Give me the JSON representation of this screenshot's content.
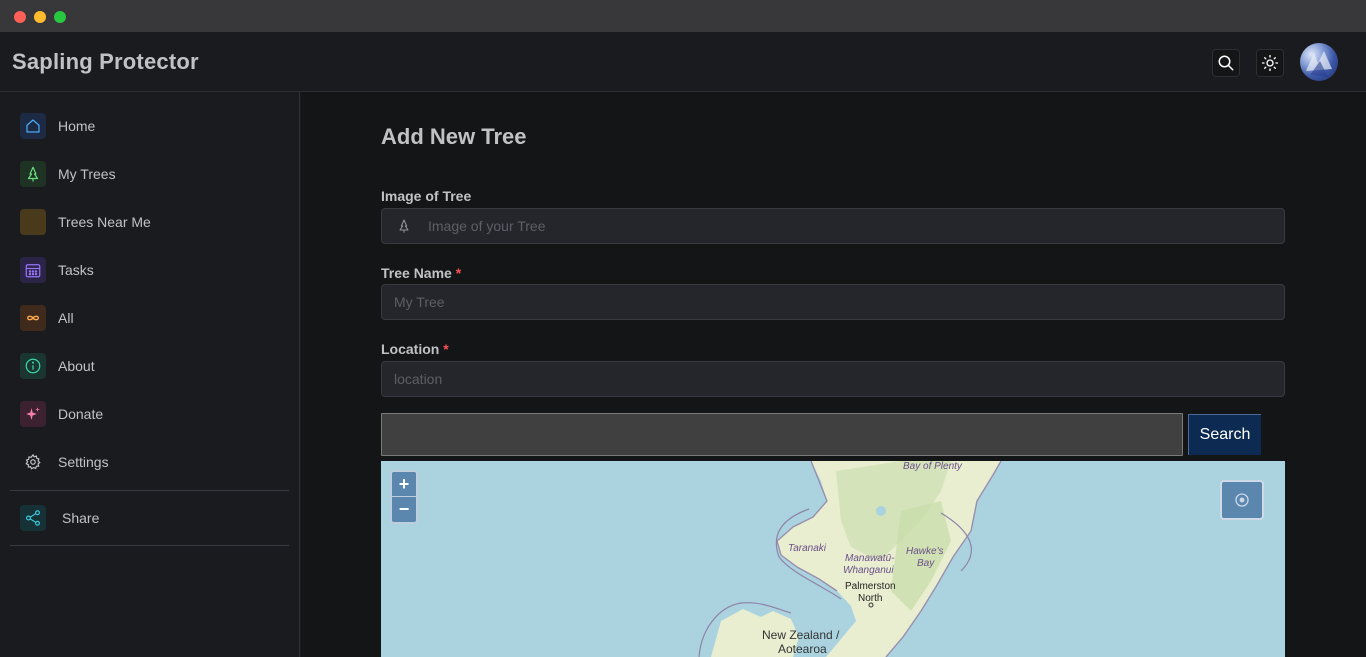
{
  "app": {
    "title": "Sapling Protector"
  },
  "sidebar": {
    "items": [
      {
        "label": "Home",
        "icon": "home-icon",
        "color": "#4dabf7",
        "bg": "#1c2a44"
      },
      {
        "label": "My Trees",
        "icon": "tree-icon",
        "color": "#69db7c",
        "bg": "#1f3324"
      },
      {
        "label": "Trees Near Me",
        "icon": "",
        "color": "#fcc419",
        "bg": "#4a3a1c"
      },
      {
        "label": "Tasks",
        "icon": "calendar-icon",
        "color": "#9775fa",
        "bg": "#2c2446"
      },
      {
        "label": "All",
        "icon": "infinity-icon",
        "color": "#ffa94d",
        "bg": "#3f2a1c"
      },
      {
        "label": "About",
        "icon": "info-icon",
        "color": "#38d9a9",
        "bg": "#1b3530"
      },
      {
        "label": "Donate",
        "icon": "sparkles-icon",
        "color": "#f783ac",
        "bg": "#3c2230"
      },
      {
        "label": "Settings",
        "icon": "gear-icon",
        "color": "#c1c2c5",
        "bg": "#1a1b1e"
      }
    ],
    "share": {
      "label": "Share",
      "icon": "share-icon",
      "color": "#3bc9db",
      "bg": "#163236"
    }
  },
  "form": {
    "title": "Add New Tree",
    "image": {
      "label": "Image of Tree",
      "placeholder": "Image of your Tree"
    },
    "name": {
      "label": "Tree Name",
      "required_mark": "*",
      "placeholder": "My Tree"
    },
    "location": {
      "label": "Location",
      "required_mark": "*",
      "placeholder": "location"
    }
  },
  "map": {
    "search_value": "",
    "search_button": "Search",
    "zoom_in": "+",
    "zoom_out": "−",
    "labels": {
      "bay_of_plenty": "Bay of Plenty",
      "taranaki": "Taranaki",
      "manawatu": "Manawatū-",
      "whanganui": "Whanganui",
      "hawkes": "Hawke's",
      "bay": "Bay",
      "palmerston": "Palmerston",
      "north": "North",
      "country_line1": "New Zealand /",
      "country_line2": "Aotearoa"
    }
  }
}
